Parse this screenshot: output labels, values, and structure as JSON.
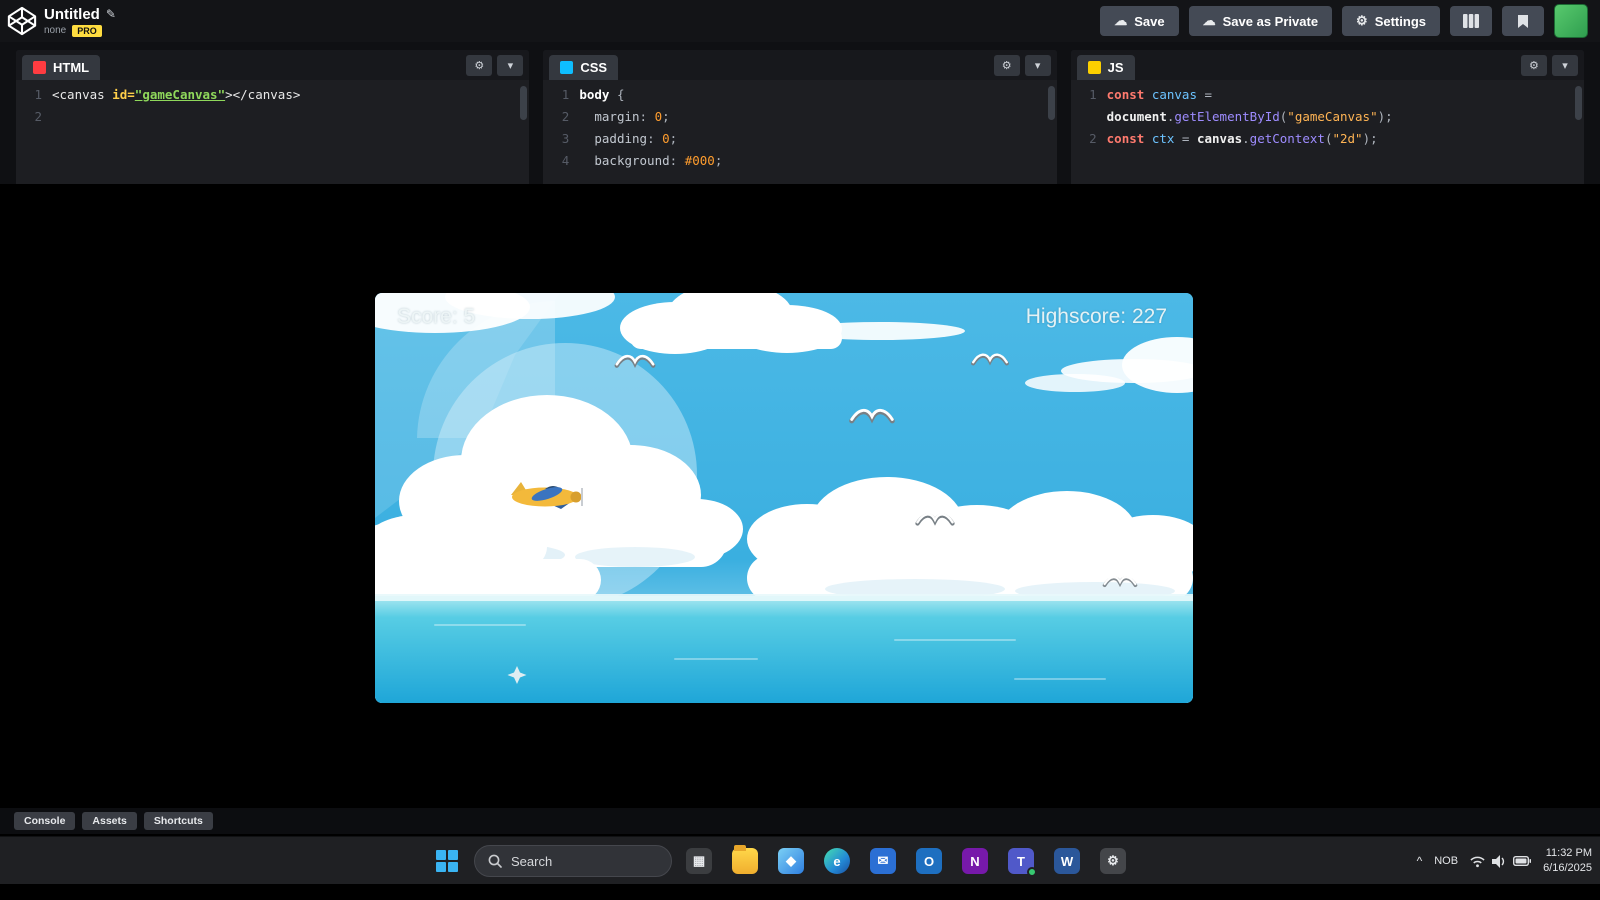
{
  "header": {
    "title": "Untitled",
    "edit_icon": "✎",
    "meta": "none",
    "pro": "PRO",
    "save": "Save",
    "save_icon": "☁",
    "save_private": "Save as Private",
    "settings": "Settings",
    "settings_icon": "⚙"
  },
  "editors": [
    {
      "label": "HTML",
      "color": "#ff3c41",
      "lines": [
        {
          "n": "1",
          "tokens": [
            {
              "t": "<canvas ",
              "c": "tag"
            },
            {
              "t": "id=",
              "c": "attr"
            },
            {
              "t": "\"gameCanvas\"",
              "c": "strg"
            },
            {
              "t": "></canvas>",
              "c": "tag"
            }
          ]
        },
        {
          "n": "2",
          "tokens": []
        }
      ]
    },
    {
      "label": "CSS",
      "color": "#0ebeff",
      "lines": [
        {
          "n": "1",
          "tokens": [
            {
              "t": "body ",
              "c": "sel"
            },
            {
              "t": "{",
              "c": "pun"
            }
          ]
        },
        {
          "n": "2",
          "tokens": [
            {
              "t": "  margin",
              "c": "prop"
            },
            {
              "t": ": ",
              "c": "pun"
            },
            {
              "t": "0",
              "c": "num"
            },
            {
              "t": ";",
              "c": "pun"
            }
          ]
        },
        {
          "n": "3",
          "tokens": [
            {
              "t": "  padding",
              "c": "prop"
            },
            {
              "t": ": ",
              "c": "pun"
            },
            {
              "t": "0",
              "c": "num"
            },
            {
              "t": ";",
              "c": "pun"
            }
          ]
        },
        {
          "n": "4",
          "tokens": [
            {
              "t": "  background",
              "c": "prop"
            },
            {
              "t": ": ",
              "c": "pun"
            },
            {
              "t": "#000",
              "c": "num"
            },
            {
              "t": ";",
              "c": "pun"
            }
          ]
        }
      ]
    },
    {
      "label": "JS",
      "color": "#fcd000",
      "lines": [
        {
          "n": "1",
          "tokens": [
            {
              "t": "const ",
              "c": "kw"
            },
            {
              "t": "canvas ",
              "c": "var"
            },
            {
              "t": "=",
              "c": "pun"
            }
          ]
        },
        {
          "n": "",
          "tokens": [
            {
              "t": "document",
              "c": "glob"
            },
            {
              "t": ".",
              "c": "pun"
            },
            {
              "t": "getElementById",
              "c": "fn"
            },
            {
              "t": "(",
              "c": "pun"
            },
            {
              "t": "\"gameCanvas\"",
              "c": "stro"
            },
            {
              "t": ")",
              "c": "pun"
            },
            {
              "t": ";",
              "c": "pun"
            }
          ]
        },
        {
          "n": "2",
          "tokens": [
            {
              "t": "const ",
              "c": "kw"
            },
            {
              "t": "ctx ",
              "c": "var"
            },
            {
              "t": "= ",
              "c": "pun"
            },
            {
              "t": "canvas",
              "c": "glob"
            },
            {
              "t": ".",
              "c": "pun"
            },
            {
              "t": "getContext",
              "c": "fn"
            },
            {
              "t": "(",
              "c": "pun"
            },
            {
              "t": "\"2d\"",
              "c": "stro"
            },
            {
              "t": ")",
              "c": "pun"
            },
            {
              "t": ";",
              "c": "pun"
            }
          ]
        }
      ]
    }
  ],
  "console_tabs": [
    "Console",
    "Assets",
    "Shortcuts"
  ],
  "game": {
    "score": "Score: 5",
    "highscore": "Highscore: 227"
  },
  "taskbar": {
    "search": "Search",
    "icons": [
      {
        "name": "widgets",
        "glyph": "▦",
        "bg": "#3b3d40",
        "fg": "#e8eaed"
      },
      {
        "name": "file-explorer",
        "glyph": "",
        "bg": "#f5b93a",
        "fg": "#fff"
      },
      {
        "name": "photos",
        "glyph": "◆",
        "bg": "#2f7fe0",
        "fg": "#ffffff"
      },
      {
        "name": "edge",
        "glyph": "e",
        "bg": "#2389d6",
        "fg": "#ffffff"
      },
      {
        "name": "mail",
        "glyph": "✉",
        "bg": "#2b6fd4",
        "fg": "#ffffff"
      },
      {
        "name": "outlook",
        "glyph": "O",
        "bg": "#1e6fc0",
        "fg": "#ffffff"
      },
      {
        "name": "onenote",
        "glyph": "N",
        "bg": "#7719aa",
        "fg": "#ffffff"
      },
      {
        "name": "teams",
        "glyph": "T",
        "bg": "#5059c9",
        "fg": "#ffffff",
        "badge": true
      },
      {
        "name": "word",
        "glyph": "W",
        "bg": "#2b579a",
        "fg": "#ffffff"
      },
      {
        "name": "settings",
        "glyph": "⚙",
        "bg": "#44464a",
        "fg": "#e8eaed"
      }
    ],
    "tray": {
      "chevron": "^",
      "lang": "NOB",
      "time": "11:32 PM",
      "date": "6/16/2025"
    }
  }
}
